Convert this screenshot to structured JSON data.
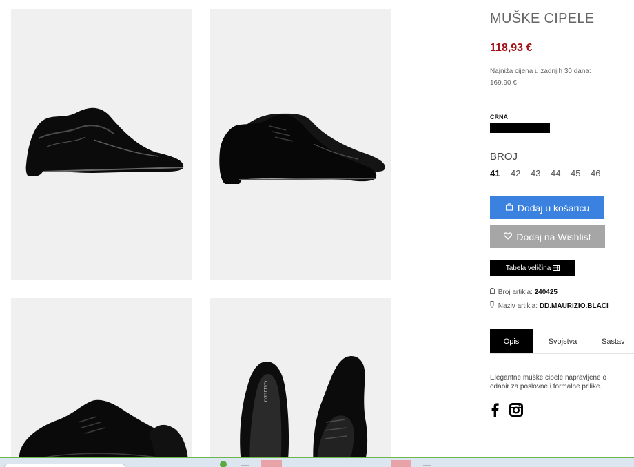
{
  "product": {
    "title": "MUŠKE CIPELE",
    "price": "118,93 €",
    "lowest_price_label": "Najniža cijena u zadnjih 30 dana:",
    "lowest_price_value": "169,90 €",
    "color_name": "CRNA",
    "color_hex": "#000000",
    "size_heading": "BROJ",
    "sizes": [
      "41",
      "42",
      "43",
      "44",
      "45",
      "46"
    ],
    "selected_size": "41"
  },
  "buttons": {
    "cart_label": "Dodaj u košaricu",
    "wishlist_label": "Dodaj na Wishlist",
    "size_table_label": "Tabela veličina"
  },
  "meta": {
    "article_number_label": "Broj artikla:",
    "article_number_value": "240425",
    "article_name_label": "Naziv artikla:",
    "article_name_value": "DD.MAURIZIO.BLACI"
  },
  "tabs": [
    "Opis",
    "Svojstva",
    "Sastav"
  ],
  "description": {
    "line1": "Elegantne muške cipele napravljene o",
    "line2": "odabir za poslovne i formalne prilike."
  },
  "photos": {
    "brand_on_insole": "GALILEO"
  },
  "colors": {
    "price": "#a11116",
    "cart_button": "#3b82e0",
    "wishlist_button": "#a6a6a6",
    "photo_bg": "#f0f0f0"
  },
  "icons": [
    "bag-icon",
    "heart-icon",
    "table-icon",
    "tag-icon",
    "label-icon",
    "facebook-icon",
    "instagram-icon"
  ]
}
